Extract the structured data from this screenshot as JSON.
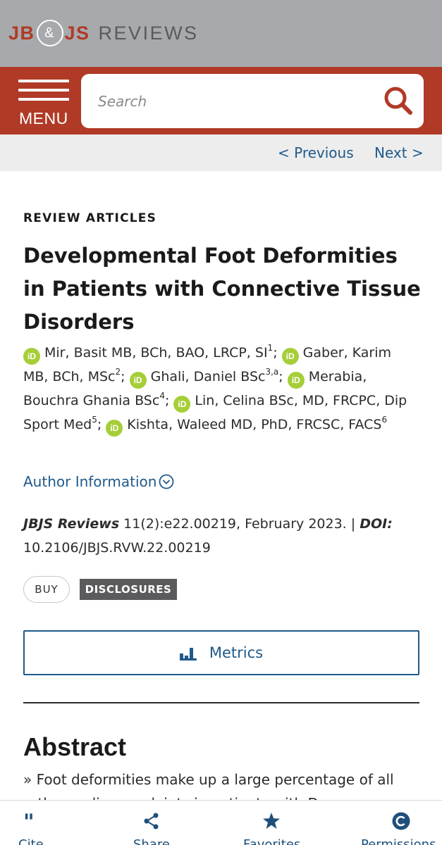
{
  "brand": {
    "part1": "JB",
    "amp": "&",
    "part2": "JS",
    "part3": "REVIEWS",
    "accent_color": "#b03a26"
  },
  "header": {
    "menu_label": "MENU",
    "menu_icon": "hamburger-icon",
    "search_placeholder": "Search",
    "search_icon": "magnifier-icon"
  },
  "pager": {
    "previous": "< Previous",
    "next": "Next >"
  },
  "article": {
    "section": "REVIEW ARTICLES",
    "title": "Developmental Foot Deformities in Patients with Connective Tissue Disorders",
    "authors": [
      {
        "name": "Mir, Basit MB, BCh, BAO, LRCP, SI",
        "sup": "1"
      },
      {
        "name": "Gaber, Karim MB, BCh, MSc",
        "sup": "2"
      },
      {
        "name": "Ghali, Daniel BSc",
        "sup": "3,a"
      },
      {
        "name": "Merabia, Bouchra Ghania BSc",
        "sup": "4"
      },
      {
        "name": "Lin, Celina BSc, MD, FRCPC, Dip Sport Med",
        "sup": "5"
      },
      {
        "name": "Kishta, Waleed MD, PhD, FRCSC, FACS",
        "sup": "6"
      }
    ],
    "orcid_label": "iD",
    "separator": ";",
    "author_info_label": "Author Information",
    "citation": {
      "journal": "JBJS Reviews",
      "details": " 11(2):e22.00219, February 2023. | ",
      "doi_label": "DOI:",
      "doi": "10.2106/JBJS.RVW.22.00219"
    },
    "buy_label": "BUY",
    "disclosures_label": "DISCLOSURES",
    "metrics_label": "Metrics",
    "abstract_heading": "Abstract",
    "abstract_first_line": "» Foot deformities make up a large percentage of all",
    "abstract_second_line": "orthopaedic complaints in patients with Ds..."
  },
  "toolbar": {
    "items": [
      {
        "label": "Cite",
        "icon": "quote-icon"
      },
      {
        "label": "Share",
        "icon": "share-icon"
      },
      {
        "label": "Favorites",
        "icon": "star-icon"
      },
      {
        "label": "Permissions",
        "icon": "copyright-icon"
      }
    ],
    "icon_color": "#1f4f7a"
  },
  "colors": {
    "link": "#1f5a8a",
    "orcid": "#a6ce39",
    "header_gray": "#a7a9ac"
  }
}
